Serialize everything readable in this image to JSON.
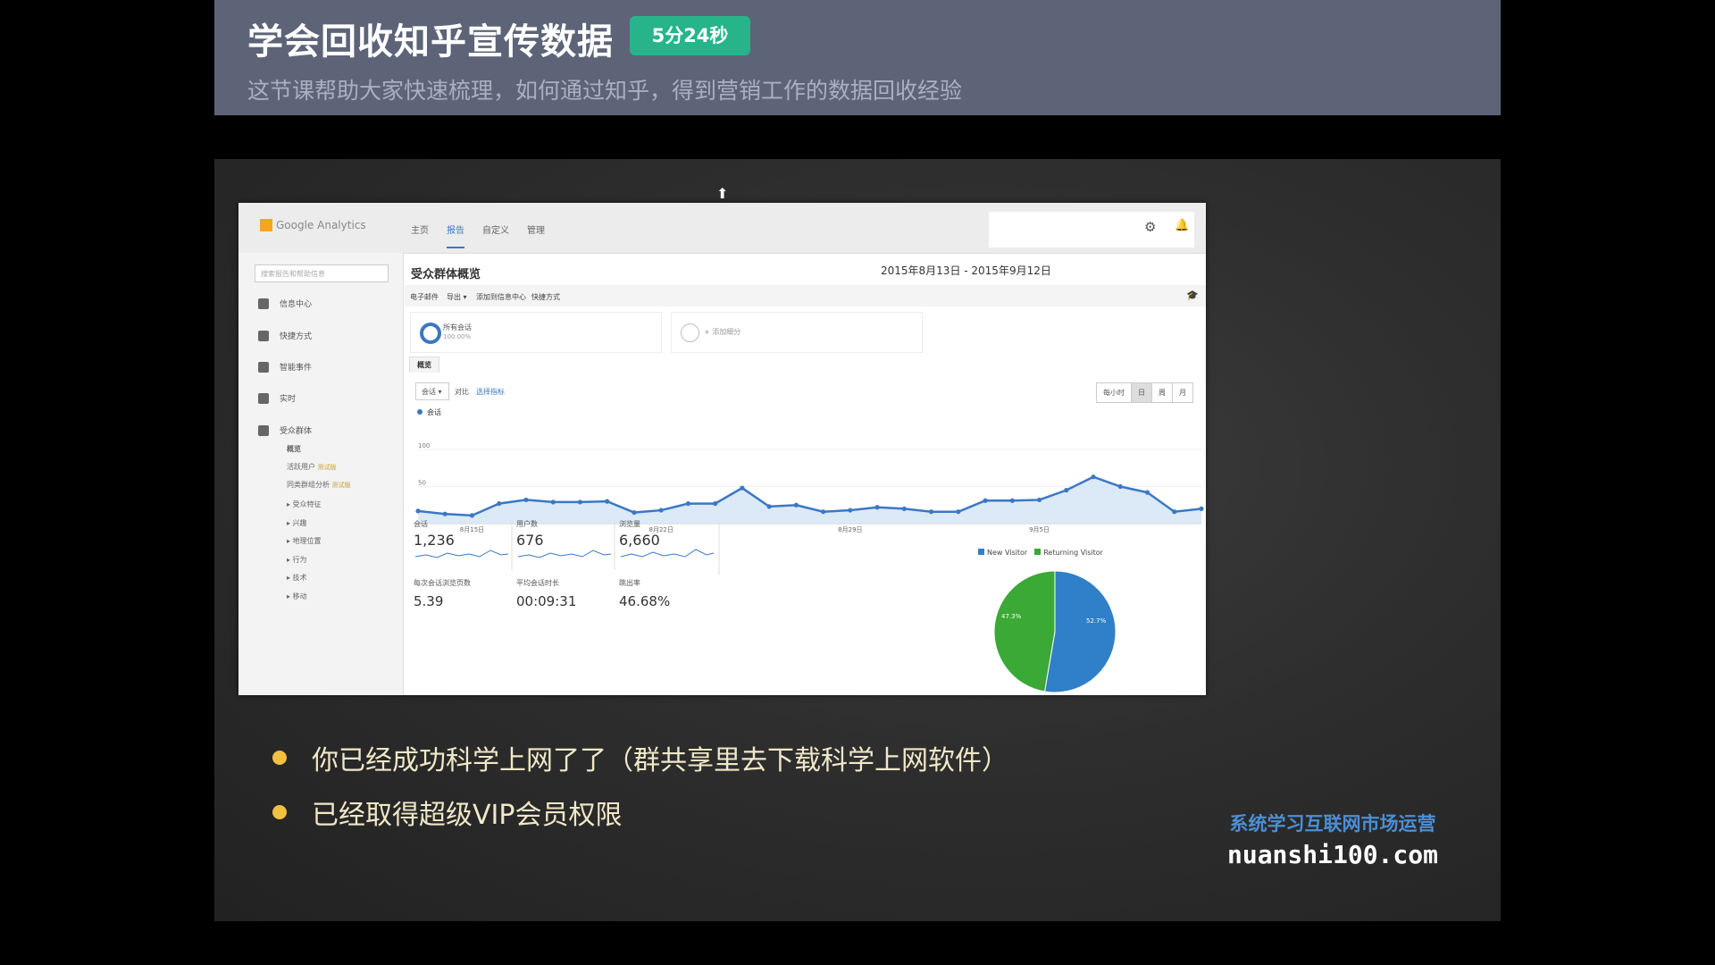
{
  "header": {
    "title": "学会回收知乎宣传数据",
    "duration_badge": "5分24秒",
    "subtitle": "这节课帮助大家快速梳理，如何通过知乎，得到营销工作的数据回收经验"
  },
  "ga": {
    "logo_text": "Google Analytics",
    "nav_tabs": [
      {
        "label": "主页"
      },
      {
        "label": "报告"
      },
      {
        "label": "自定义"
      },
      {
        "label": "管理"
      }
    ],
    "active_tab_index": 1,
    "sidebar": {
      "search_placeholder": "搜索报告和帮助信息",
      "items": [
        {
          "label": "信息中心",
          "icon": "dashboard-icon"
        },
        {
          "label": "快捷方式",
          "icon": "shortcut-icon"
        },
        {
          "label": "智能事件",
          "icon": "location-pin-icon"
        },
        {
          "label": "实时",
          "icon": "realtime-icon"
        },
        {
          "label": "受众群体",
          "icon": "people-icon"
        }
      ],
      "sub_items": [
        {
          "label": "概览",
          "tag": ""
        },
        {
          "label": "活跃用户",
          "tag": "测试版"
        },
        {
          "label": "同类群组分析",
          "tag": "测试版"
        },
        {
          "label": "▸ 受众特征",
          "tag": ""
        },
        {
          "label": "▸ 兴趣",
          "tag": ""
        },
        {
          "label": "▸ 地理位置",
          "tag": ""
        },
        {
          "label": "▸ 行为",
          "tag": ""
        },
        {
          "label": "▸ 技术",
          "tag": ""
        },
        {
          "label": "▸ 移动",
          "tag": ""
        }
      ]
    },
    "page_title": "受众群体概览",
    "date_range": "2015年8月13日 - 2015年9月12日",
    "toolbar": {
      "email": "电子邮件",
      "export": "导出 ▾",
      "add_dashboard": "添加到信息中心",
      "shortcut": "快捷方式"
    },
    "segments": {
      "all_sessions": "所有会话",
      "all_sessions_pct": "100.00%",
      "add_segment": "+ 添加细分"
    },
    "overview_tab": "概览",
    "metric_selector": "会话 ▾",
    "vs_label": "对比",
    "pick_metric": "选择指标",
    "granularity": [
      "每小时",
      "日",
      "周",
      "月"
    ],
    "active_granularity_index": 1,
    "series_label": "会话",
    "kpis": [
      {
        "label": "会话",
        "value": "1,236"
      },
      {
        "label": "用户数",
        "value": "676"
      },
      {
        "label": "浏览量",
        "value": "6,660"
      },
      {
        "label": "每次会话浏览页数",
        "value": "5.39"
      },
      {
        "label": "平均会话时长",
        "value": "00:09:31"
      },
      {
        "label": "跳出率",
        "value": "46.68%"
      }
    ],
    "pie_legend": {
      "new_visitor": "New Visitor",
      "returning_visitor": "Returning Visitor"
    }
  },
  "chart_data": [
    {
      "type": "area",
      "series": [
        {
          "name": "会话",
          "values": [
            17,
            13,
            11,
            27,
            32,
            29,
            29,
            30,
            15,
            18,
            27,
            27,
            48,
            23,
            25,
            16,
            18,
            22,
            20,
            16,
            16,
            31,
            31,
            32,
            45,
            63,
            50,
            42,
            16,
            20
          ]
        }
      ],
      "x_tick_labels": [
        "8月15日",
        "8月22日",
        "8月29日",
        "9月5日"
      ],
      "y_tick_labels": [
        "100",
        "50"
      ],
      "ylim": [
        0,
        100
      ],
      "grid": true,
      "color": "#3b78c4"
    },
    {
      "type": "pie",
      "categories": [
        "New Visitor",
        "Returning Visitor"
      ],
      "values": [
        52.7,
        47.3
      ],
      "slice_labels": [
        "52.7%",
        "47.3%"
      ],
      "colors": [
        "#2f80c8",
        "#3aa935"
      ],
      "legend": "top"
    }
  ],
  "bullets": [
    "你已经成功科学上网了了（群共享里去下载科学上网软件）",
    "已经取得超级VIP会员权限"
  ],
  "brand": {
    "tagline": "系统学习互联网市场运营",
    "domain": "nuanshi100.com"
  }
}
